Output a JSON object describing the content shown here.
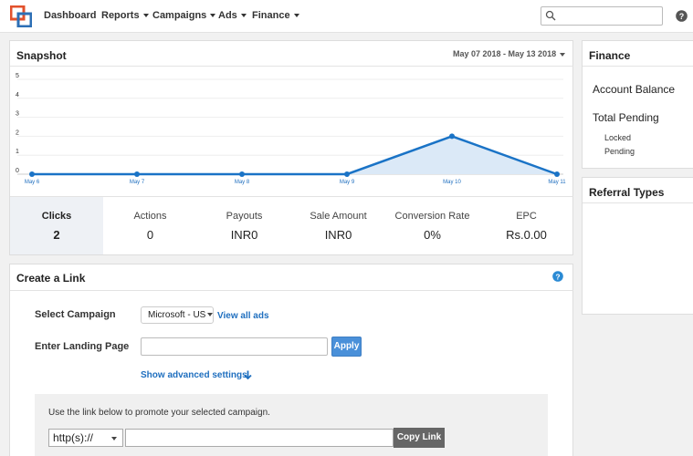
{
  "nav": {
    "items": [
      {
        "label": "Dashboard",
        "dropdown": false,
        "active": true
      },
      {
        "label": "Reports",
        "dropdown": true,
        "active": false
      },
      {
        "label": "Campaigns",
        "dropdown": true,
        "active": false
      },
      {
        "label": "Ads",
        "dropdown": true,
        "active": false
      },
      {
        "label": "Finance",
        "dropdown": true,
        "active": false
      }
    ],
    "search_value": "",
    "accent": "#1f6fbf"
  },
  "snapshot": {
    "title": "Snapshot",
    "date_range": "May 07 2018 - May 13 2018",
    "stats": [
      {
        "label": "Clicks",
        "value": "2",
        "active": true
      },
      {
        "label": "Actions",
        "value": "0",
        "active": false
      },
      {
        "label": "Payouts",
        "value": "INR0",
        "active": false
      },
      {
        "label": "Sale Amount",
        "value": "INR0",
        "active": false
      },
      {
        "label": "Conversion Rate",
        "value": "0%",
        "active": false
      },
      {
        "label": "EPC",
        "value": "Rs.0.00",
        "active": false
      }
    ]
  },
  "chart_data": {
    "type": "area",
    "categories": [
      "May 6",
      "May 7",
      "May 8",
      "May 9",
      "May 10",
      "May 11"
    ],
    "series": [
      {
        "values": [
          0,
          0,
          0,
          0,
          2,
          0
        ]
      }
    ],
    "y_ticks": [
      "0",
      "1",
      "2",
      "3",
      "4",
      "5"
    ],
    "ylim": [
      0,
      5
    ],
    "grid": true,
    "line_color": "#1a73c6",
    "fill_color": "#dbe9f7"
  },
  "create_link": {
    "title": "Create a Link",
    "select_campaign_label": "Select Campaign",
    "campaign_value": "Microsoft - US",
    "view_all_ads": "View all ads",
    "landing_page_label": "Enter Landing Page",
    "landing_page_value": "",
    "apply_label": "Apply",
    "advanced_label": "Show advanced settings",
    "promo_text": "Use the link below to promote your selected campaign.",
    "protocol_value": "http(s)://",
    "url_value": "",
    "copy_label": "Copy Link"
  },
  "finance": {
    "title": "Finance",
    "account_balance": "Account Balance",
    "total_pending": "Total Pending",
    "locked": "Locked",
    "pending": "Pending"
  },
  "referral": {
    "title": "Referral Types"
  }
}
